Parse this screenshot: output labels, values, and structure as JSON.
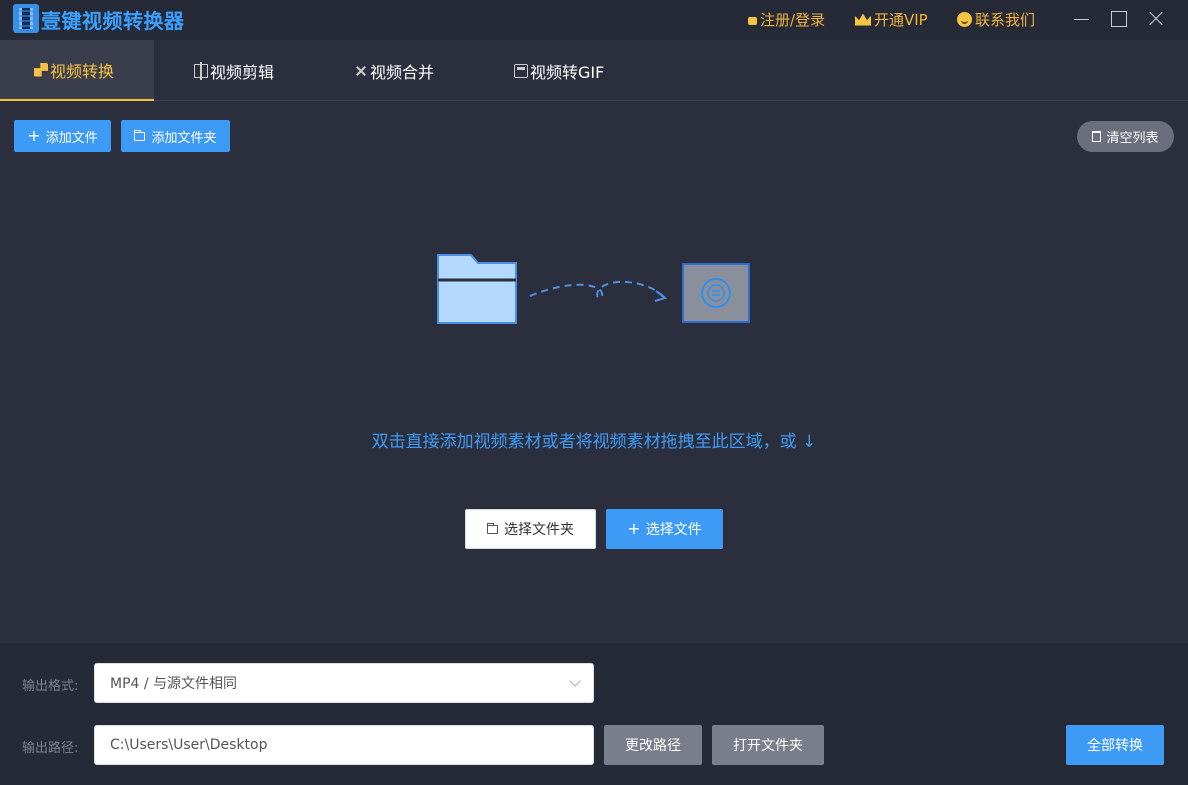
{
  "app": {
    "title": "壹键视频转换器"
  },
  "header": {
    "login": "注册/登录",
    "vip": "开通VIP",
    "contact": "联系我们"
  },
  "tabs": [
    {
      "label": "视频转换",
      "icon": "convert-icon",
      "active": true
    },
    {
      "label": "视频剪辑",
      "icon": "cut-icon",
      "active": false
    },
    {
      "label": "视频合并",
      "icon": "merge-icon",
      "active": false
    },
    {
      "label": "视频转GIF",
      "icon": "gif-icon",
      "active": false
    }
  ],
  "toolbar": {
    "add_file": "添加文件",
    "add_folder": "添加文件夹",
    "clear_list": "清空列表"
  },
  "dropzone": {
    "hint": "双击直接添加视频素材或者将视频素材拖拽至此区域，或 ↓",
    "select_folder": "选择文件夹",
    "select_file": "选择文件"
  },
  "output": {
    "format_label": "输出格式:",
    "format_value": "MP4 / 与源文件相同",
    "path_label": "输出路径:",
    "path_value": "C:\\Users\\User\\Desktop",
    "change_path": "更改路径",
    "open_folder": "打开文件夹",
    "convert_all": "全部转换"
  },
  "colors": {
    "accent": "#3d9bf5",
    "active_tab": "#f5c242",
    "background": "#2b2f3d",
    "panel": "#262a36"
  }
}
